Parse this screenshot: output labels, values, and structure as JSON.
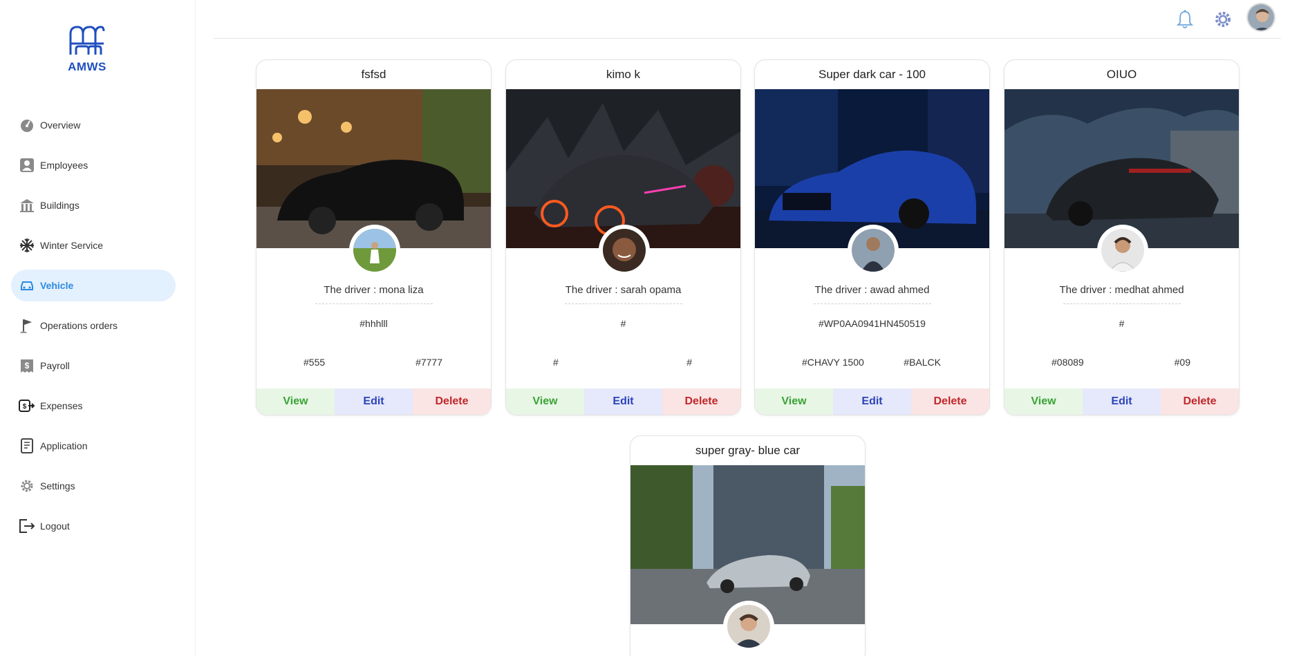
{
  "brand": {
    "name": "AMWS",
    "color": "#1f4fbf"
  },
  "sidebar": {
    "items": [
      {
        "label": "Overview",
        "icon": "gauge-icon",
        "active": false
      },
      {
        "label": "Employees",
        "icon": "user-icon",
        "active": false
      },
      {
        "label": "Buildings",
        "icon": "building-icon",
        "active": false
      },
      {
        "label": "Winter Service",
        "icon": "snowflake-icon",
        "active": false
      },
      {
        "label": "Vehicle",
        "icon": "car-icon",
        "active": true
      },
      {
        "label": "Operations orders",
        "icon": "flag-icon",
        "active": false
      },
      {
        "label": "Payroll",
        "icon": "dollar-receipt-icon",
        "active": false
      },
      {
        "label": "Expenses",
        "icon": "money-out-icon",
        "active": false
      },
      {
        "label": "Application",
        "icon": "document-icon",
        "active": false
      },
      {
        "label": "Settings",
        "icon": "gear-icon",
        "active": false
      },
      {
        "label": "Logout",
        "icon": "logout-icon",
        "active": false
      }
    ]
  },
  "header": {
    "icons": [
      "bell-icon",
      "gear-icon",
      "avatar"
    ]
  },
  "vehicles": [
    {
      "title": "fsfsd",
      "driver": "The driver : mona liza",
      "plate": "#hhhlll",
      "spec_left": "#555",
      "spec_right": "#7777",
      "view": "View",
      "edit": "Edit",
      "delete": "Delete"
    },
    {
      "title": "kimo k",
      "driver": "The driver : sarah opama",
      "plate": "#",
      "spec_left": "#",
      "spec_right": "#",
      "view": "View",
      "edit": "Edit",
      "delete": "Delete"
    },
    {
      "title": "Super dark car - 100",
      "driver": "The driver : awad ahmed",
      "plate": "#WP0AA0941HN450519",
      "spec_left": "#CHAVY 1500",
      "spec_right": "#BALCK",
      "view": "View",
      "edit": "Edit",
      "delete": "Delete"
    },
    {
      "title": "OIUO",
      "driver": "The driver : medhat ahmed",
      "plate": "#",
      "spec_left": "#08089",
      "spec_right": "#09",
      "view": "View",
      "edit": "Edit",
      "delete": "Delete"
    },
    {
      "title": "super gray- blue car",
      "driver": "",
      "plate": "",
      "spec_left": "",
      "spec_right": "",
      "view": "",
      "edit": "",
      "delete": ""
    }
  ],
  "colors": {
    "accent": "#2b8ae0",
    "active_bg": "#e3f0fd",
    "view": "#3aa335",
    "edit": "#2b44b8",
    "delete": "#c0282a"
  }
}
